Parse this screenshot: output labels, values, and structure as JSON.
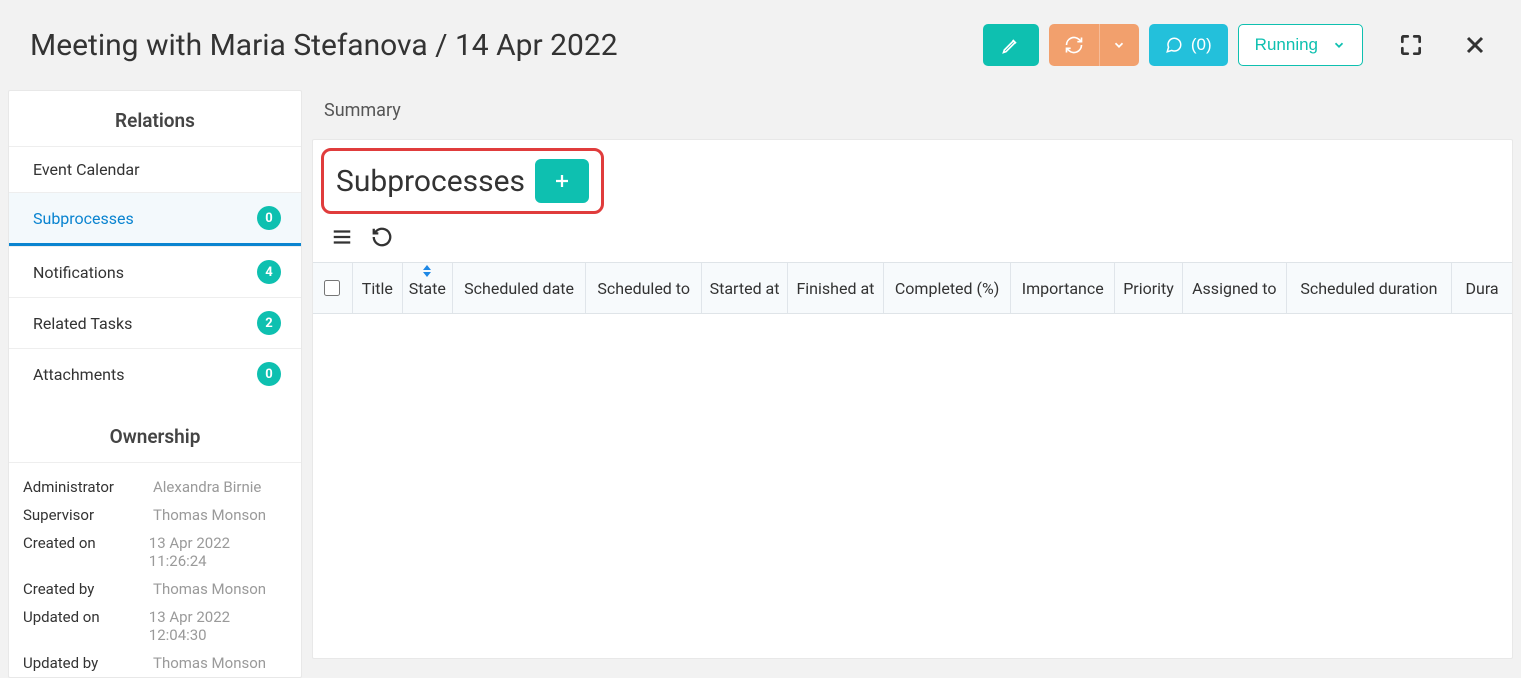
{
  "header": {
    "title": "Meeting with Maria Stefanova / 14 Apr 2022",
    "comments_label": "(0)",
    "status": {
      "label": "Running"
    }
  },
  "sidebar": {
    "relations_title": "Relations",
    "items": [
      {
        "label": "Event Calendar",
        "count": null
      },
      {
        "label": "Subprocesses",
        "count": "0",
        "active": true
      },
      {
        "label": "Notifications",
        "count": "4"
      },
      {
        "label": "Related Tasks",
        "count": "2"
      },
      {
        "label": "Attachments",
        "count": "0"
      }
    ],
    "ownership_title": "Ownership",
    "ownership": [
      {
        "label": "Administrator",
        "value": "Alexandra Birnie"
      },
      {
        "label": "Supervisor",
        "value": "Thomas Monson"
      },
      {
        "label": "Created on",
        "value": "13 Apr 2022 11:26:24"
      },
      {
        "label": "Created by",
        "value": "Thomas Monson"
      },
      {
        "label": "Updated on",
        "value": "13 Apr 2022 12:04:30"
      },
      {
        "label": "Updated by",
        "value": "Thomas Monson"
      }
    ]
  },
  "main": {
    "summary_label": "Summary",
    "section_title": "Subprocesses",
    "columns": [
      "Title",
      "State",
      "Scheduled date",
      "Scheduled to",
      "Started at",
      "Finished at",
      "Completed (%)",
      "Importance",
      "Priority",
      "Assigned to",
      "Scheduled duration",
      "Dura"
    ]
  },
  "colors": {
    "teal": "#0ec0b0",
    "orange": "#f2a06d",
    "cyan": "#23c0db",
    "highlight_red": "#e03c3c",
    "link_blue": "#0a84d0"
  }
}
